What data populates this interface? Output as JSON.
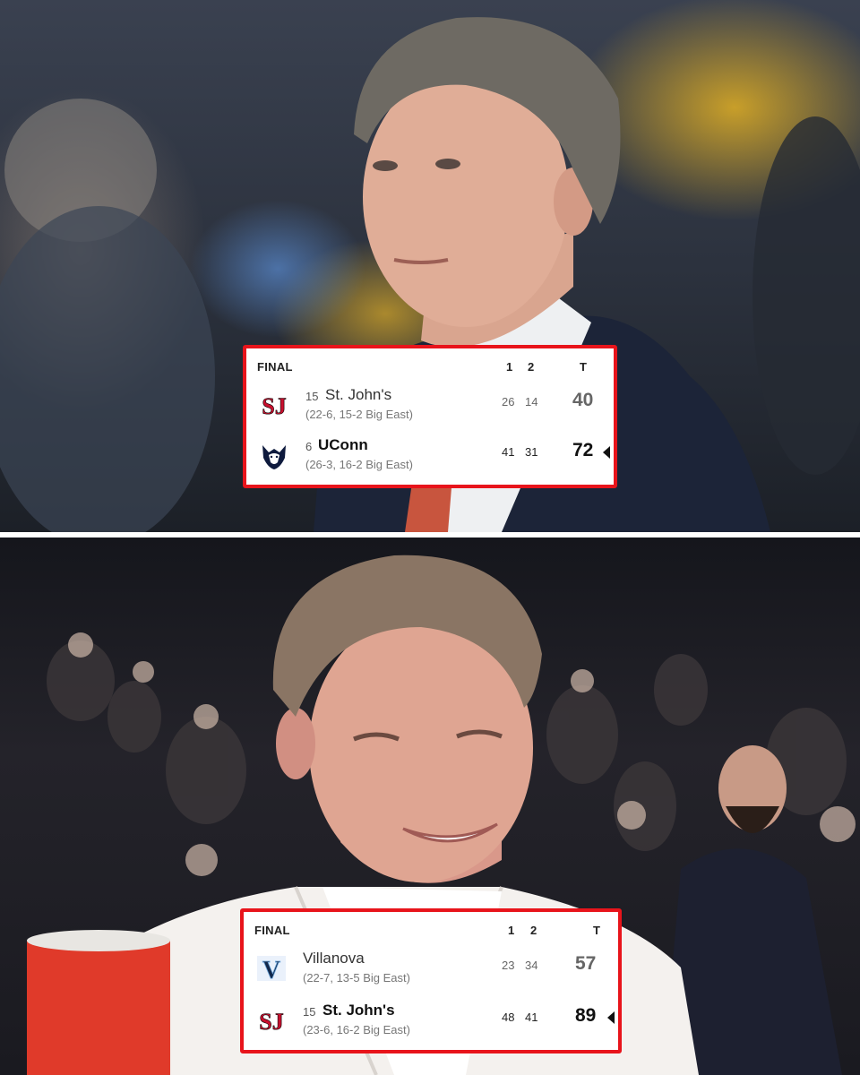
{
  "colors": {
    "card_border": "#e8141b",
    "st_johns_red": "#c8102e",
    "uconn_navy": "#0e1a3d",
    "villanova_navy": "#13294b"
  },
  "top_card": {
    "status": "FINAL",
    "columns": [
      "1",
      "2",
      "T"
    ],
    "teams": [
      {
        "logo": "st-johns-logo",
        "logo_text": "SJ",
        "rank": "15",
        "name": "St. John's",
        "record": "(22-6, 15-2 Big East)",
        "q1": "26",
        "q2": "14",
        "total": "40",
        "winner": false
      },
      {
        "logo": "uconn-husky-logo",
        "logo_text": "",
        "rank": "6",
        "name": "UConn",
        "record": "(26-3, 16-2 Big East)",
        "q1": "41",
        "q2": "31",
        "total": "72",
        "winner": true
      }
    ]
  },
  "bottom_card": {
    "status": "FINAL",
    "columns": [
      "1",
      "2",
      "T"
    ],
    "teams": [
      {
        "logo": "villanova-logo",
        "logo_text": "V",
        "rank": "",
        "name": "Villanova",
        "record": "(22-7, 13-5 Big East)",
        "q1": "23",
        "q2": "34",
        "total": "57",
        "winner": false
      },
      {
        "logo": "st-johns-logo",
        "logo_text": "SJ",
        "rank": "15",
        "name": "St. John's",
        "record": "(23-6, 16-2 Big East)",
        "q1": "48",
        "q2": "41",
        "total": "89",
        "winner": true
      }
    ]
  }
}
